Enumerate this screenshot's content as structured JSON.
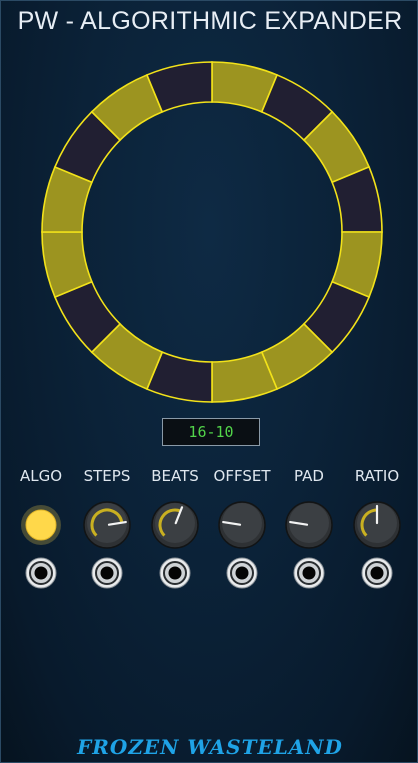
{
  "module": {
    "title": "PW - ALGORITHMIC EXPANDER",
    "brand": "FROZEN WASTELAND"
  },
  "ring": {
    "segments": 16,
    "active_pattern": [
      1,
      0,
      1,
      0,
      1,
      0,
      1,
      1,
      0,
      1,
      0,
      1,
      1,
      0,
      1,
      0
    ],
    "colors": {
      "active": "#9c9420",
      "inactive": "#211f32",
      "stroke": "#f2e21a"
    }
  },
  "display": {
    "value": "16-10"
  },
  "controls": [
    {
      "label": "ALGO",
      "type": "button",
      "color": "#ffd84a"
    },
    {
      "label": "STEPS",
      "type": "knob",
      "level": 0.8,
      "arc": true
    },
    {
      "label": "BEATS",
      "type": "knob",
      "level": 0.58,
      "arc": true
    },
    {
      "label": "OFFSET",
      "type": "knob",
      "level": 0.2,
      "arc": false
    },
    {
      "label": "PAD",
      "type": "knob",
      "level": 0.2,
      "arc": false
    },
    {
      "label": "RATIO",
      "type": "knob",
      "level": 0.5,
      "arc": true
    }
  ]
}
